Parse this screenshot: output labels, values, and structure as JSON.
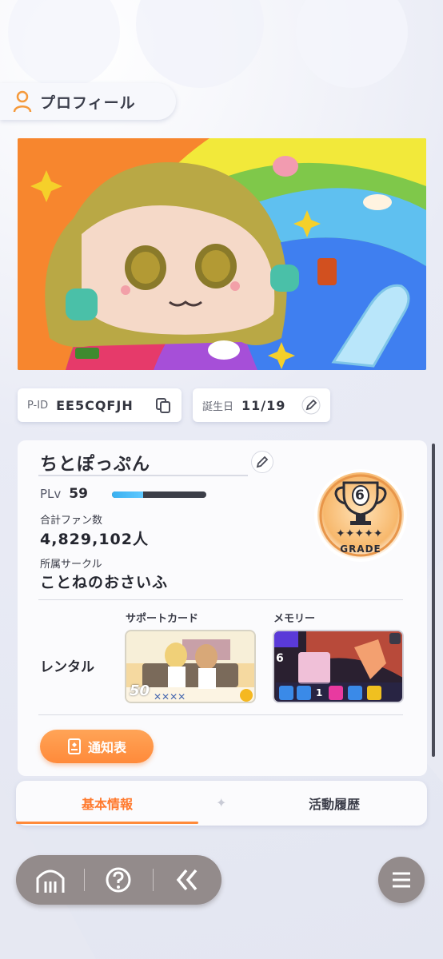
{
  "header": {
    "title": "プロフィール",
    "icon": "person-icon"
  },
  "profile": {
    "pid_label": "P-ID",
    "pid_value": "EE5CQFJH",
    "birthday_label": "誕生日",
    "birthday_value": "11/19",
    "name": "ちとぽっぷん",
    "plv_label": "PLv",
    "plv_value": "59",
    "plv_progress": 0.33,
    "fans_label": "合計ファン数",
    "fans_value": "4,829,102人",
    "circle_label": "所属サークル",
    "circle_value": "ことねのおさいふ",
    "grade_number": "6",
    "grade_label": "GRADE"
  },
  "rental": {
    "label": "レンタル",
    "support_card_label": "サポートカード",
    "support_card_level": "50",
    "memory_label": "メモリー",
    "memory_number": "6",
    "memory_badge": "1"
  },
  "notify_button": {
    "label": "通知表"
  },
  "tabs": [
    {
      "label": "基本情報",
      "active": true
    },
    {
      "label": "活動履歴",
      "active": false
    }
  ],
  "nav": {
    "home": "home-icon",
    "help": "help-icon",
    "back": "back-icon",
    "menu": "menu-icon"
  },
  "colors": {
    "accent": "#ff8a3a",
    "nav": "#938b8b",
    "progress": "#3ab0f0"
  }
}
